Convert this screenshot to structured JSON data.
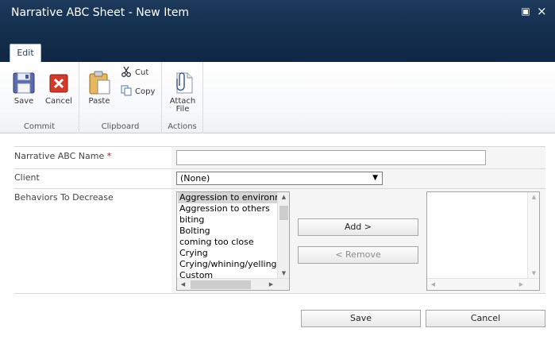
{
  "window": {
    "title": "Narrative ABC Sheet - New Item",
    "restore_glyph": "▣",
    "close_glyph": "×"
  },
  "tabs": [
    {
      "label": "Edit"
    }
  ],
  "ribbon": {
    "commit": {
      "label": "Commit",
      "save_label": "Save",
      "cancel_label": "Cancel"
    },
    "clipboard": {
      "label": "Clipboard",
      "paste_label": "Paste",
      "cut_label": "Cut",
      "copy_label": "Copy"
    },
    "actions": {
      "label": "Actions",
      "attach_label_line1": "Attach",
      "attach_label_line2": "File"
    }
  },
  "form": {
    "name_field": {
      "label": "Narrative ABC Name",
      "required_mark": "*",
      "value": ""
    },
    "client_field": {
      "label": "Client",
      "selected": "(None)",
      "arrow": "▼"
    },
    "behaviors_field": {
      "label": "Behaviors To Decrease",
      "available": [
        "Aggression to environment",
        "Aggression to others",
        "biting",
        "Bolting",
        "coming too close",
        "Crying",
        "Crying/whining/yelling",
        "Custom"
      ],
      "add_label": "Add >",
      "remove_label": "< Remove"
    }
  },
  "footer": {
    "save_label": "Save",
    "cancel_label": "Cancel"
  },
  "colors": {
    "title_bar": "#14304f",
    "required": "#cc0000",
    "selected_item": "#d4d4d4"
  }
}
